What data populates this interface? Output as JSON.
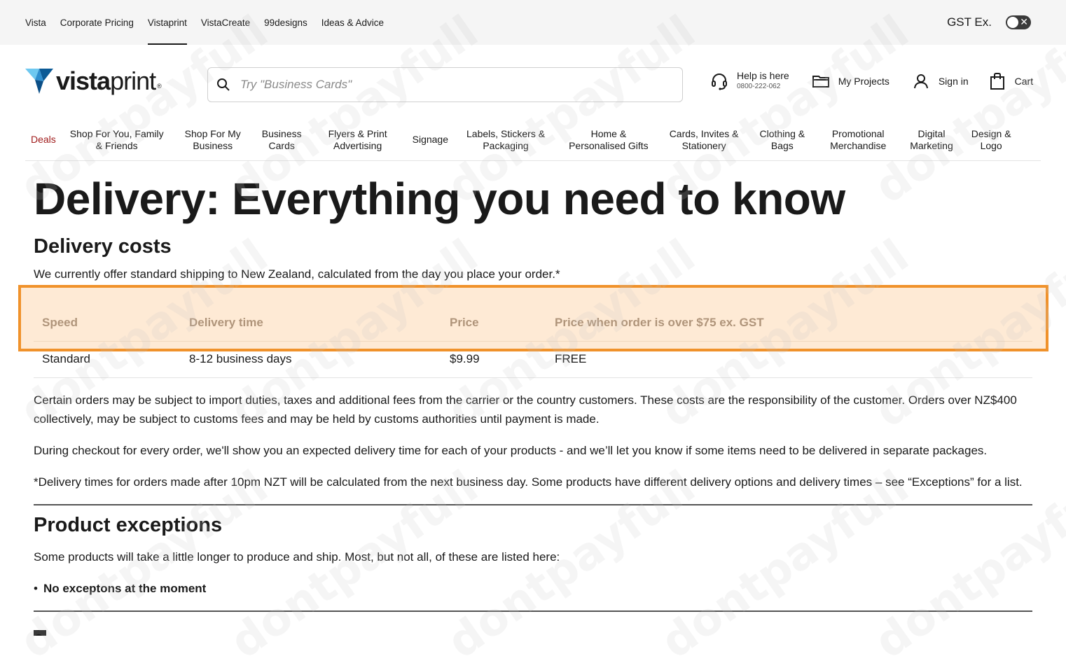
{
  "utility_bar": {
    "links": [
      "Vista",
      "Corporate Pricing",
      "Vistaprint",
      "VistaCreate",
      "99designs",
      "Ideas & Advice"
    ],
    "active_index": 2,
    "gst_label": "GST Ex.",
    "gst_toggle_state": "off"
  },
  "header": {
    "logo_bold": "vista",
    "logo_light": "print",
    "logo_reg": "®",
    "search_placeholder": "Try \"Business Cards\"",
    "help_label": "Help is here",
    "help_phone": "0800-222-062",
    "projects_label": "My Projects",
    "signin_label": "Sign in",
    "cart_label": "Cart"
  },
  "category_nav": {
    "items": [
      [
        "Deals"
      ],
      [
        "Shop For You, Family",
        "& Friends"
      ],
      [
        "Shop For My",
        "Business"
      ],
      [
        "Business",
        "Cards"
      ],
      [
        "Flyers & Print",
        "Advertising"
      ],
      [
        "Signage"
      ],
      [
        "Labels, Stickers &",
        "Packaging"
      ],
      [
        "Home &",
        "Personalised Gifts"
      ],
      [
        "Cards, Invites &",
        "Stationery"
      ],
      [
        "Clothing &",
        "Bags"
      ],
      [
        "Promotional",
        "Merchandise"
      ],
      [
        "Digital",
        "Marketing"
      ],
      [
        "Design &",
        "Logo"
      ]
    ],
    "deals_color": "#a01c1c"
  },
  "main": {
    "title": "Delivery: Everything you need to know",
    "costs_heading": "Delivery costs",
    "intro": "We currently offer standard shipping to New Zealand, calculated from the day you place your order.*",
    "table": {
      "headers": [
        "Speed",
        "Delivery time",
        "Price",
        "Price when order is over $75 ex. GST"
      ],
      "rows": [
        [
          "Standard",
          "8-12 business days",
          "$9.99",
          "FREE"
        ]
      ]
    },
    "para_customs": "Certain orders may be subject to import duties, taxes and additional fees from the carrier or the country customers. These costs are the responsibility of the customer. Orders over NZ$400 collectively, may be subject to customs fees and may be held by customs authorities until payment is made.",
    "para_checkout": "During checkout for every order, we'll show you an expected delivery time for each of your products - and we’ll let you know if some items need to be delivered in separate packages.",
    "para_footnote": "*Delivery times for orders made after 10pm NZT will be calculated from the next business day. Some products have different delivery options and delivery times – see “Exceptions” for a list.",
    "exceptions_heading": "Product exceptions",
    "exceptions_intro": "Some products will take a little longer to produce and ship. Most, but not all, of these are listed here:",
    "exceptions_items": [
      "No exceptons at the moment"
    ]
  },
  "colors": {
    "highlight_border": "#f0922b",
    "highlight_fill": "#fde3cc",
    "logo_blue_dark": "#0b5a96",
    "logo_blue_light": "#6ec8f0"
  },
  "watermark": "dontpayfull"
}
